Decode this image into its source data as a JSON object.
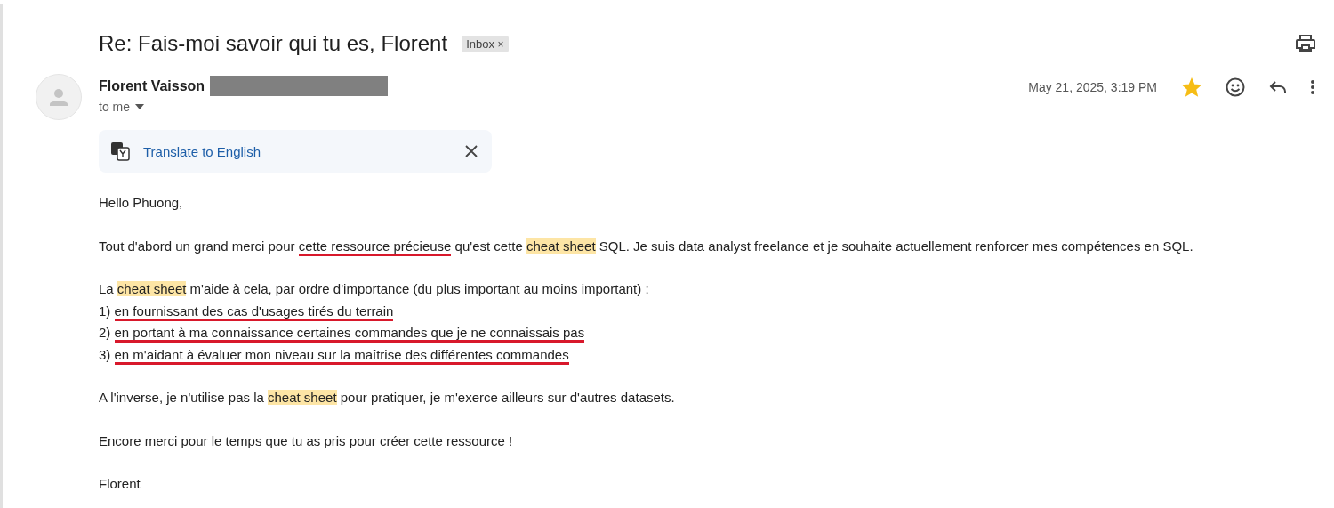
{
  "subject": {
    "title": "Re: Fais-moi savoir qui tu es, Florent",
    "label": {
      "text": "Inbox",
      "close": "×"
    }
  },
  "sender": {
    "name": "Florent Vaisson",
    "redacted": true,
    "recipient": "to me",
    "date": "May 21, 2025, 3:19 PM",
    "starred": true
  },
  "translate": {
    "label": "Translate to English"
  },
  "body": [
    {
      "lines": [
        [
          {
            "kind": "plain",
            "text": "Hello Phuong,"
          }
        ]
      ]
    },
    {
      "lines": [
        [
          {
            "kind": "plain",
            "text": "Tout d'abord un grand merci pour "
          },
          {
            "kind": "underline",
            "text": "cette ressource précieuse"
          },
          {
            "kind": "plain",
            "text": " qu'est cette "
          },
          {
            "kind": "highlight",
            "text": "cheat sheet"
          },
          {
            "kind": "plain",
            "text": " SQL. Je suis data analyst freelance et je souhaite actuellement renforcer mes compétences en SQL."
          }
        ]
      ]
    },
    {
      "lines": [
        [
          {
            "kind": "plain",
            "text": "La "
          },
          {
            "kind": "highlight",
            "text": "cheat sheet"
          },
          {
            "kind": "plain",
            "text": " m'aide à cela, par ordre d'importance (du plus important au moins important) :"
          }
        ],
        [
          {
            "kind": "plain",
            "text": "1) "
          },
          {
            "kind": "underline",
            "text": "en fournissant des cas d'usages tirés du terrain"
          }
        ],
        [
          {
            "kind": "plain",
            "text": "2) "
          },
          {
            "kind": "underline",
            "text": "en portant à ma connaissance certaines commandes que je ne connaissais pas"
          }
        ],
        [
          {
            "kind": "plain",
            "text": "3) "
          },
          {
            "kind": "underline",
            "text": "en m'aidant à évaluer mon niveau sur la maîtrise des différentes commandes"
          }
        ]
      ]
    },
    {
      "lines": [
        [
          {
            "kind": "plain",
            "text": "A l'inverse, je n'utilise pas la "
          },
          {
            "kind": "highlight",
            "text": "cheat sheet"
          },
          {
            "kind": "plain",
            "text": " pour pratiquer, je m'exerce ailleurs sur d'autres datasets."
          }
        ]
      ]
    },
    {
      "lines": [
        [
          {
            "kind": "plain",
            "text": "Encore merci pour le temps que tu as pris pour créer cette ressource !"
          }
        ]
      ]
    },
    {
      "lines": [
        [
          {
            "kind": "plain",
            "text": "Florent"
          }
        ]
      ]
    }
  ]
}
